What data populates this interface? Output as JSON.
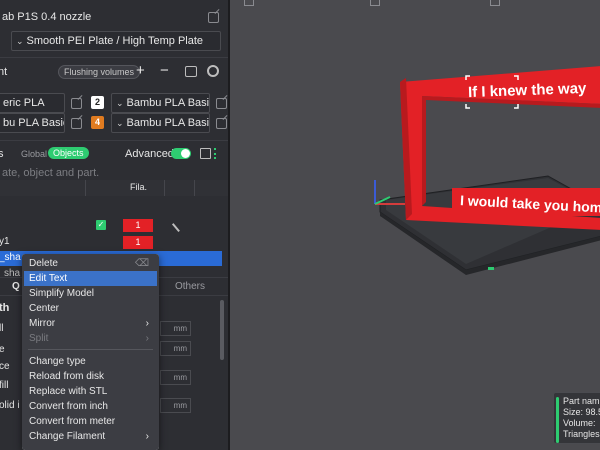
{
  "printer": {
    "name": "ab P1S 0.4 nozzle",
    "plate": "Smooth PEI Plate / High Temp Plate"
  },
  "filament_header": {
    "label": "nt",
    "flushing_label": "Flushing volumes",
    "add": "+",
    "remove": "−"
  },
  "filaments": [
    {
      "name": "eric PLA",
      "slot": "2",
      "slot_color": "#ffffff",
      "slot_text_color": "#222222",
      "material": "Bambu PLA Basic"
    },
    {
      "name": "bu PLA Basic",
      "slot": "4",
      "slot_color": "#e07b20",
      "slot_text_color": "#ffffff",
      "material": "Bambu PLA Basic"
    }
  ],
  "process": {
    "label": "s",
    "tab_global": "Global",
    "tab_objects": "Objects",
    "advanced_label": "Advanced",
    "search_placeholder": "ate, object and part."
  },
  "object_table": {
    "fila_header": "Fila.",
    "rows": [
      {
        "name": "",
        "fila": "1"
      },
      {
        "name": "y1",
        "fila": "1"
      }
    ],
    "selected_name": "_sha"
  },
  "settings_tabs": {
    "tab_q": "Q",
    "tab_others": "Others"
  },
  "settings_rows": [
    {
      "label": "th"
    },
    {
      "label": "ll"
    },
    {
      "label": "e"
    },
    {
      "label": "ce"
    },
    {
      "label": "fill"
    },
    {
      "label": "olid i"
    }
  ],
  "units": {
    "mm": "mm"
  },
  "context_menu": {
    "items": [
      {
        "label": "Delete"
      },
      {
        "label": "Edit Text"
      },
      {
        "label": "Simplify Model"
      },
      {
        "label": "Center"
      },
      {
        "label": "Mirror"
      },
      {
        "label": "Split"
      },
      {
        "label": "Change type"
      },
      {
        "label": "Reload from disk"
      },
      {
        "label": "Replace with STL"
      },
      {
        "label": "Convert from inch"
      },
      {
        "label": "Convert from meter"
      },
      {
        "label": "Change Filament"
      }
    ]
  },
  "viewport": {
    "text_top": "If I knew the way",
    "text_bottom": "I would take you home"
  },
  "info_panel": {
    "part_name": "Part nam",
    "size": "Size: 98.5",
    "volume": "Volume: ",
    "triangles": "Triangles"
  },
  "colors": {
    "accent_green": "#2ecc71",
    "selection_blue": "#2a6bd6",
    "model_red": "#e32126"
  }
}
